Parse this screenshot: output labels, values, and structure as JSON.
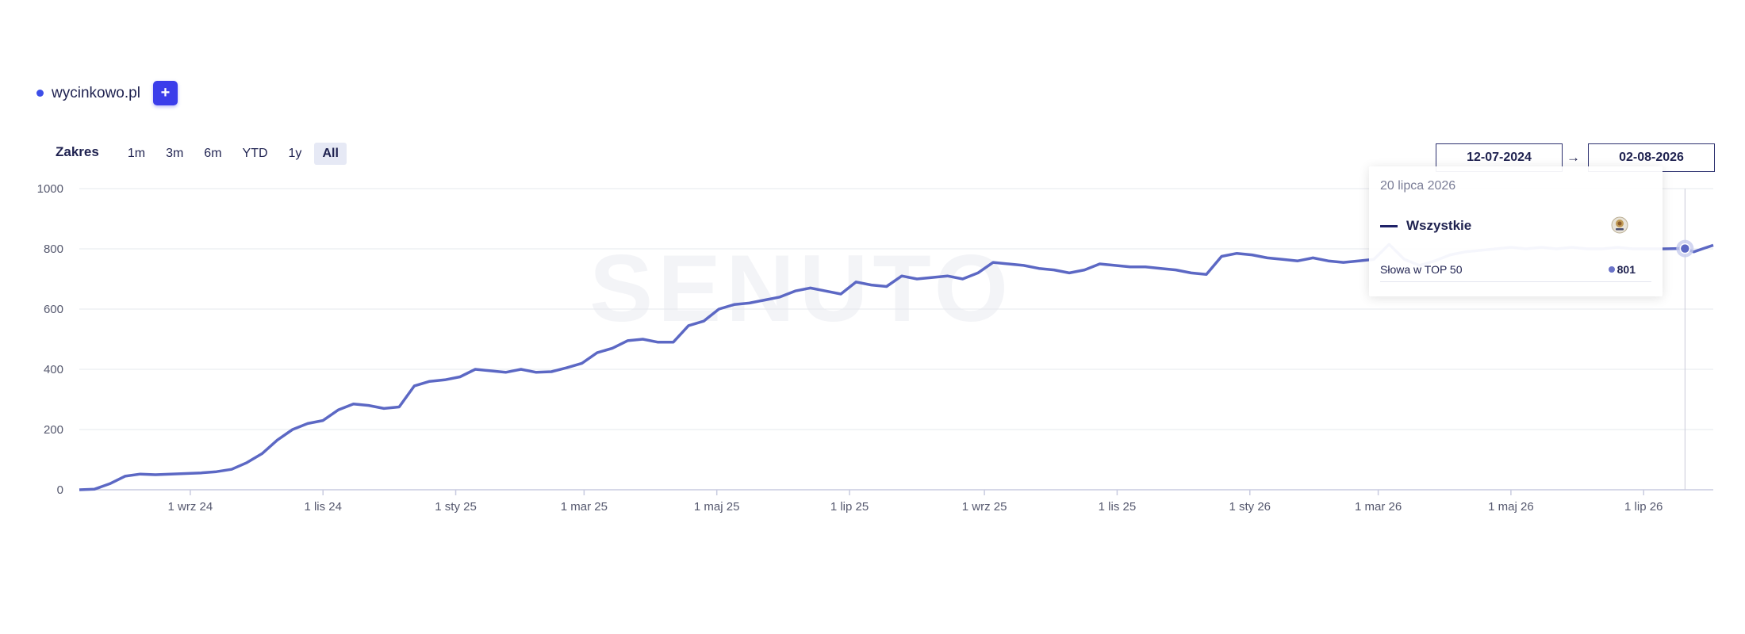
{
  "legend": {
    "site_label": "wycinkowo.pl",
    "dot_color": "#3d4ee8",
    "add_label": "+"
  },
  "range": {
    "label": "Zakres",
    "buttons": [
      "1m",
      "3m",
      "6m",
      "YTD",
      "1y",
      "All"
    ],
    "active": "All"
  },
  "dates": {
    "from": "12-07-2024",
    "arrow": "→",
    "to": "02-08-2026"
  },
  "watermark": "SENUTO",
  "tooltip": {
    "date": "20 lipca 2026",
    "series_name": "Wszystkie",
    "metric_label": "Słowa w TOP 50",
    "metric_value": "801",
    "icon": "seal-icon"
  },
  "chart_data": {
    "type": "line",
    "x_start": "2024-07-12",
    "x_end": "2026-08-02",
    "ylim": [
      0,
      1000
    ],
    "y_ticks": [
      0,
      200,
      400,
      600,
      800,
      1000
    ],
    "x_ticks": [
      {
        "date": "2024-09-01",
        "label": "1 wrz 24"
      },
      {
        "date": "2024-11-01",
        "label": "1 lis 24"
      },
      {
        "date": "2025-01-01",
        "label": "1 sty 25"
      },
      {
        "date": "2025-03-01",
        "label": "1 mar 25"
      },
      {
        "date": "2025-05-01",
        "label": "1 maj 25"
      },
      {
        "date": "2025-07-01",
        "label": "1 lip 25"
      },
      {
        "date": "2025-09-01",
        "label": "1 wrz 25"
      },
      {
        "date": "2025-11-01",
        "label": "1 lis 25"
      },
      {
        "date": "2026-01-01",
        "label": "1 sty 26"
      },
      {
        "date": "2026-03-01",
        "label": "1 mar 26"
      },
      {
        "date": "2026-05-01",
        "label": "1 maj 26"
      },
      {
        "date": "2026-07-01",
        "label": "1 lip 26"
      }
    ],
    "grid": true,
    "line_color": "#5c68c4",
    "series": [
      {
        "points": [
          [
            "2024-07-12",
            0
          ],
          [
            "2024-07-19",
            2
          ],
          [
            "2024-07-26",
            20
          ],
          [
            "2024-08-02",
            45
          ],
          [
            "2024-08-09",
            52
          ],
          [
            "2024-08-16",
            50
          ],
          [
            "2024-08-23",
            52
          ],
          [
            "2024-08-30",
            54
          ],
          [
            "2024-09-06",
            56
          ],
          [
            "2024-09-13",
            60
          ],
          [
            "2024-09-20",
            68
          ],
          [
            "2024-09-27",
            90
          ],
          [
            "2024-10-04",
            120
          ],
          [
            "2024-10-11",
            165
          ],
          [
            "2024-10-18",
            200
          ],
          [
            "2024-10-25",
            220
          ],
          [
            "2024-11-01",
            230
          ],
          [
            "2024-11-08",
            265
          ],
          [
            "2024-11-15",
            285
          ],
          [
            "2024-11-22",
            280
          ],
          [
            "2024-11-29",
            270
          ],
          [
            "2024-12-06",
            275
          ],
          [
            "2024-12-13",
            345
          ],
          [
            "2024-12-20",
            360
          ],
          [
            "2024-12-27",
            365
          ],
          [
            "2025-01-03",
            375
          ],
          [
            "2025-01-10",
            400
          ],
          [
            "2025-01-17",
            395
          ],
          [
            "2025-01-24",
            390
          ],
          [
            "2025-01-31",
            400
          ],
          [
            "2025-02-07",
            390
          ],
          [
            "2025-02-14",
            392
          ],
          [
            "2025-02-21",
            405
          ],
          [
            "2025-02-28",
            420
          ],
          [
            "2025-03-07",
            455
          ],
          [
            "2025-03-14",
            470
          ],
          [
            "2025-03-21",
            495
          ],
          [
            "2025-03-28",
            500
          ],
          [
            "2025-04-04",
            490
          ],
          [
            "2025-04-11",
            490
          ],
          [
            "2025-04-18",
            545
          ],
          [
            "2025-04-25",
            560
          ],
          [
            "2025-05-02",
            600
          ],
          [
            "2025-05-09",
            615
          ],
          [
            "2025-05-16",
            620
          ],
          [
            "2025-05-23",
            630
          ],
          [
            "2025-05-30",
            640
          ],
          [
            "2025-06-06",
            660
          ],
          [
            "2025-06-13",
            670
          ],
          [
            "2025-06-20",
            660
          ],
          [
            "2025-06-27",
            650
          ],
          [
            "2025-07-04",
            690
          ],
          [
            "2025-07-11",
            680
          ],
          [
            "2025-07-18",
            675
          ],
          [
            "2025-07-25",
            710
          ],
          [
            "2025-08-01",
            700
          ],
          [
            "2025-08-08",
            705
          ],
          [
            "2025-08-15",
            710
          ],
          [
            "2025-08-22",
            700
          ],
          [
            "2025-08-29",
            720
          ],
          [
            "2025-09-05",
            755
          ],
          [
            "2025-09-12",
            750
          ],
          [
            "2025-09-19",
            745
          ],
          [
            "2025-09-26",
            735
          ],
          [
            "2025-10-03",
            730
          ],
          [
            "2025-10-10",
            720
          ],
          [
            "2025-10-17",
            730
          ],
          [
            "2025-10-24",
            750
          ],
          [
            "2025-10-31",
            745
          ],
          [
            "2025-11-07",
            740
          ],
          [
            "2025-11-14",
            740
          ],
          [
            "2025-11-21",
            735
          ],
          [
            "2025-11-28",
            730
          ],
          [
            "2025-12-05",
            720
          ],
          [
            "2025-12-12",
            715
          ],
          [
            "2025-12-19",
            775
          ],
          [
            "2025-12-26",
            785
          ],
          [
            "2026-01-02",
            780
          ],
          [
            "2026-01-09",
            770
          ],
          [
            "2026-01-16",
            765
          ],
          [
            "2026-01-23",
            760
          ],
          [
            "2026-01-30",
            770
          ],
          [
            "2026-02-06",
            760
          ],
          [
            "2026-02-13",
            755
          ],
          [
            "2026-02-20",
            760
          ],
          [
            "2026-02-27",
            765
          ],
          [
            "2026-03-06",
            815
          ],
          [
            "2026-03-13",
            765
          ],
          [
            "2026-03-20",
            745
          ],
          [
            "2026-03-27",
            760
          ],
          [
            "2026-04-03",
            780
          ],
          [
            "2026-04-10",
            790
          ],
          [
            "2026-04-17",
            795
          ],
          [
            "2026-04-24",
            800
          ],
          [
            "2026-05-01",
            805
          ],
          [
            "2026-05-08",
            800
          ],
          [
            "2026-05-15",
            805
          ],
          [
            "2026-05-22",
            800
          ],
          [
            "2026-05-29",
            805
          ],
          [
            "2026-06-05",
            800
          ],
          [
            "2026-06-12",
            800
          ],
          [
            "2026-06-19",
            805
          ],
          [
            "2026-06-26",
            800
          ],
          [
            "2026-07-03",
            800
          ],
          [
            "2026-07-10",
            800
          ],
          [
            "2026-07-17",
            801
          ],
          [
            "2026-07-20",
            801
          ],
          [
            "2026-07-24",
            790
          ],
          [
            "2026-07-28",
            800
          ],
          [
            "2026-08-02",
            812
          ]
        ]
      }
    ],
    "highlight": {
      "date": "2026-07-20",
      "value": 801
    }
  }
}
